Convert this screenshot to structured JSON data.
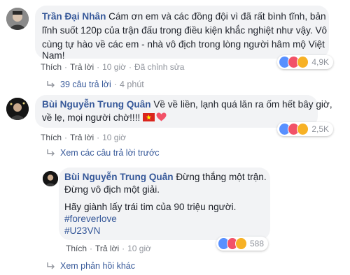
{
  "comments": [
    {
      "author": "Trần Đại Nhân",
      "lines": [
        " Cám ơn em và các đồng đội vì đã rất bình tĩnh, bản",
        "lĩnh suốt 120p của trận đấu trong điều kiện khắc nghiệt như vậy. Vô",
        "cùng tự hào về các em - nhà vô địch trong lòng người hâm mộ Việt",
        "Nam!"
      ],
      "actions": {
        "like": "Thích",
        "reply": "Trả lời",
        "time": "10 giờ",
        "edited": "Đã chỉnh sửa"
      },
      "reaction_count": "4,9K",
      "replies_link": "39 câu trả lời",
      "replies_time": "4 phút"
    },
    {
      "author": "Bùi Nguyễn Trung Quân",
      "lines": [
        " Về về liền, lạnh quá lăn ra ốm hết bây giờ,",
        "về lẹ, mọi người chờ!!!! "
      ],
      "actions": {
        "like": "Thích",
        "reply": "Trả lời",
        "time": "10 giờ"
      },
      "reaction_count": "2,5K",
      "previous_replies": "Xem các câu trả lời trước"
    },
    {
      "author": "Bùi Nguyễn Trung Quân",
      "lines": [
        " Đừng thắng một trận.",
        "Đừng vô địch một giải.",
        "",
        "Hãy giành lấy trái tim của 90 triệu người.",
        "#foreverlove",
        "#U23VN"
      ],
      "actions": {
        "like": "Thích",
        "reply": "Trả lời",
        "time": "10 giờ"
      },
      "reaction_count": "588",
      "more_replies": "Xem phản hồi khác"
    }
  ],
  "icons": {
    "like": "#5890ff",
    "love": "#f25268",
    "haha": "#f7b125",
    "heart_emoji": "#f25268",
    "vietnam_flag_red": "#da251d",
    "vietnam_flag_star": "#ffff00"
  }
}
